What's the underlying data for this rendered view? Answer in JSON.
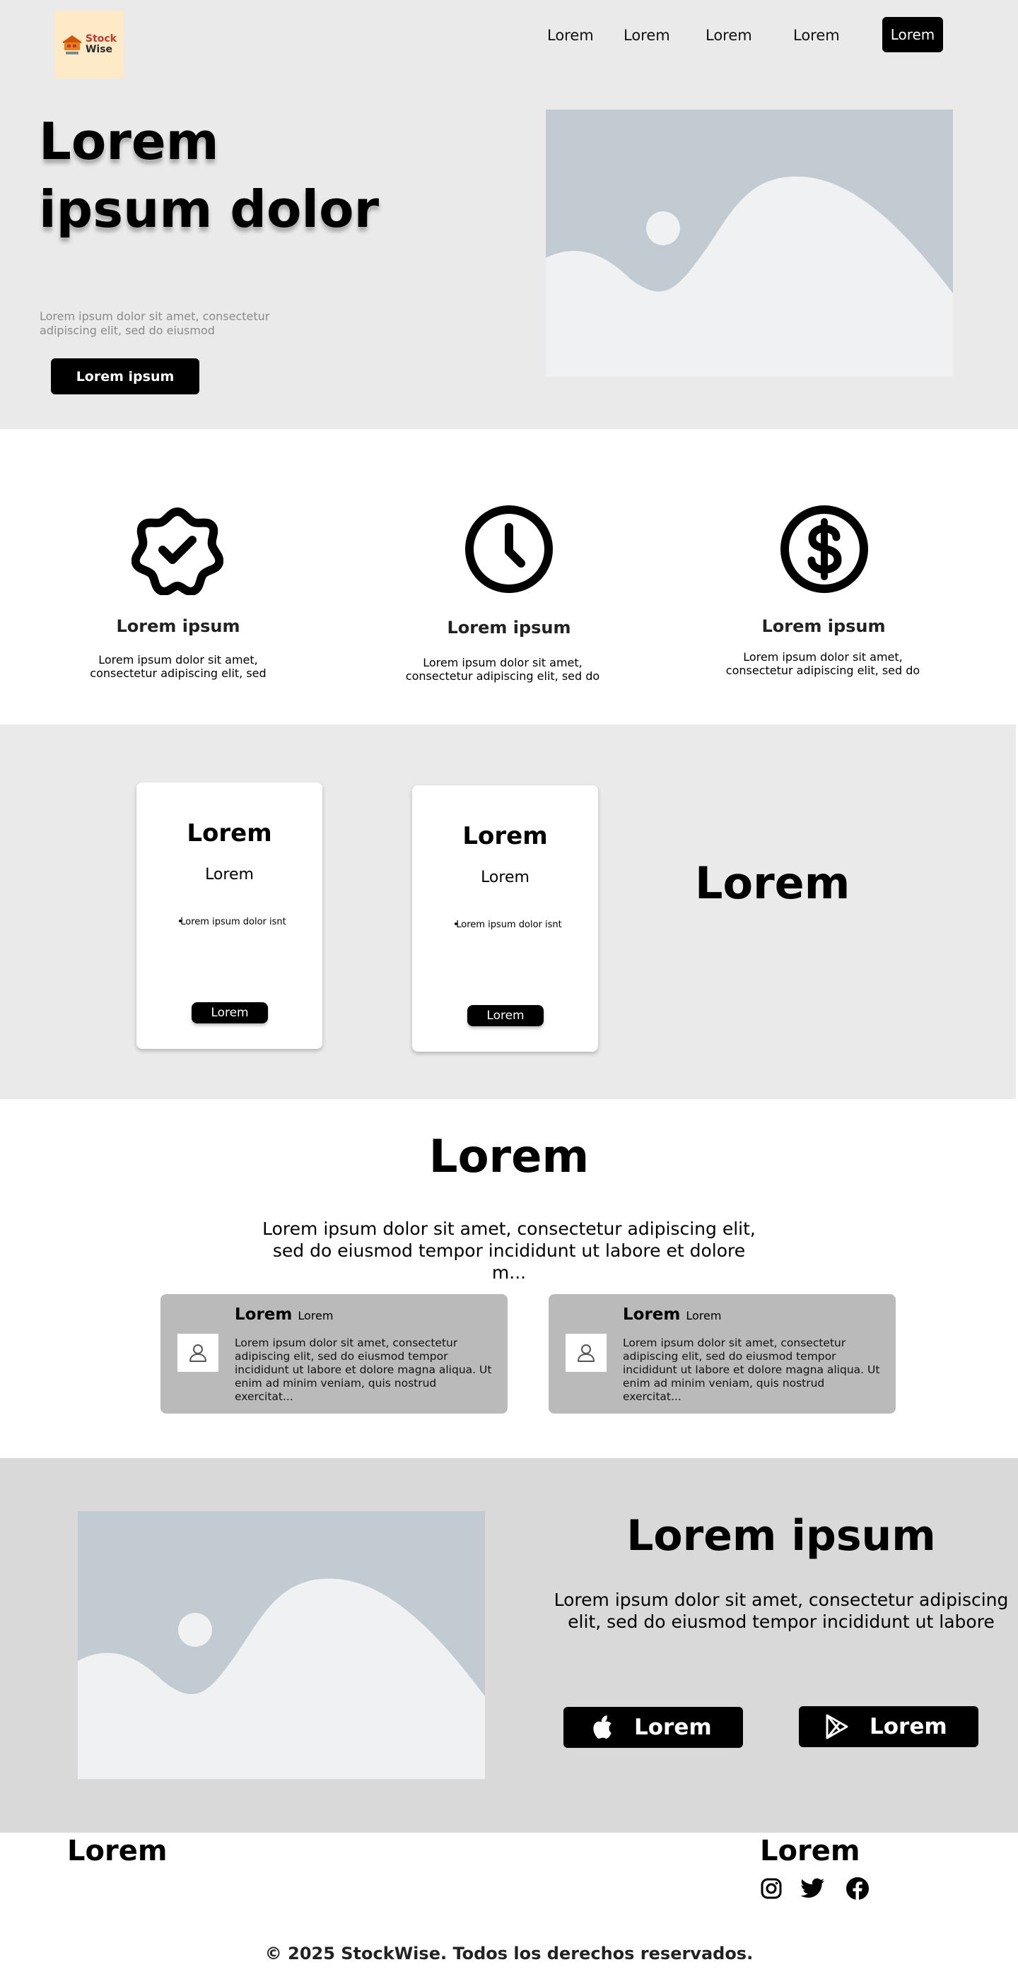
{
  "header": {
    "logo_line1": "Stock",
    "logo_line2": "Wise",
    "nav": [
      "Lorem",
      "Lorem",
      "Lorem",
      "Lorem"
    ],
    "cta": "Lorem"
  },
  "hero": {
    "title": "Lorem ipsum dolor",
    "subtitle": "Lorem ipsum dolor sit amet, consectetur adipiscing elit, sed do eiusmod",
    "button": "Lorem ipsum"
  },
  "features": [
    {
      "icon": "badge-check-icon",
      "title": "Lorem ipsum",
      "text": "Lorem ipsum dolor sit amet, consectetur adipiscing elit, sed"
    },
    {
      "icon": "clock-icon",
      "title": "Lorem ipsum",
      "text": "Lorem ipsum dolor sit amet, consectetur adipiscing elit, sed do"
    },
    {
      "icon": "dollar-icon",
      "title": "Lorem ipsum",
      "text": "Lorem ipsum dolor sit amet, consectetur adipiscing elit, sed do"
    }
  ],
  "pricing": {
    "cards": [
      {
        "title": "Lorem",
        "subtitle": "Lorem",
        "item": "Lorem ipsum dolor isnt",
        "button": "Lorem"
      },
      {
        "title": "Lorem",
        "subtitle": "Lorem",
        "item": "Lorem ipsum dolor isnt",
        "button": "Lorem"
      }
    ],
    "side_heading": "Lorem"
  },
  "testimonials": {
    "title": "Lorem",
    "subtitle": "Lorem ipsum dolor sit amet, consectetur adipiscing elit, sed do eiusmod tempor incididunt ut labore et dolore m...",
    "items": [
      {
        "name": "Lorem",
        "role": "Lorem",
        "text": "Lorem ipsum dolor sit amet, consectetur adipiscing elit, sed do eiusmod tempor incididunt ut labore et dolore magna aliqua. Ut enim ad minim veniam, quis nostrud exercitat..."
      },
      {
        "name": "Lorem",
        "role": "Lorem",
        "text": "Lorem ipsum dolor sit amet, consectetur adipiscing elit, sed do eiusmod tempor incididunt ut labore et dolore magna aliqua. Ut enim ad minim veniam, quis nostrud exercitat..."
      }
    ]
  },
  "app": {
    "title": "Lorem ipsum",
    "subtitle": "Lorem ipsum dolor sit amet, consectetur adipiscing elit, sed do eiusmod tempor incididunt ut labore",
    "apple_button": "Lorem",
    "play_button": "Lorem"
  },
  "footer": {
    "left_heading": "Lorem",
    "right_heading": "Lorem",
    "socials": [
      "instagram-icon",
      "twitter-icon",
      "facebook-icon"
    ],
    "copyright": "© 2025 StockWise. Todos los derechos reservados."
  },
  "colors": {
    "hero_bg": "#eaeaea",
    "section_bg": "#d9d9d9",
    "logo_bg": "#ffeac8",
    "card_gray": "#bababa",
    "placeholder_sky": "#c2cad2",
    "placeholder_land": "#eff1f3",
    "button": "#000000"
  }
}
